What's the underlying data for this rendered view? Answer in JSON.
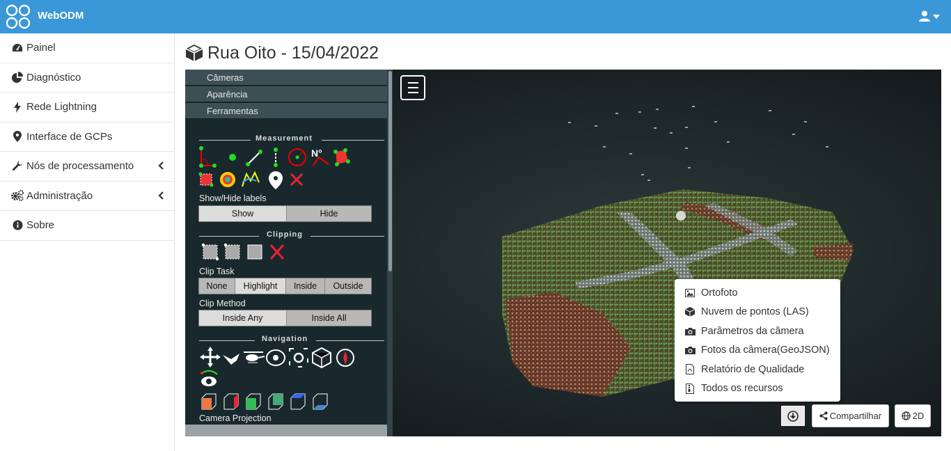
{
  "app": {
    "brand": "WebODM"
  },
  "sidebar": {
    "items": [
      {
        "label": "Painel",
        "icon": "dashboard-icon"
      },
      {
        "label": "Diagnóstico",
        "icon": "pie-chart-icon"
      },
      {
        "label": "Rede Lightning",
        "icon": "bolt-icon"
      },
      {
        "label": "Interface de GCPs",
        "icon": "map-marker-icon"
      },
      {
        "label": "Nós de processamento",
        "icon": "wrench-icon"
      },
      {
        "label": "Administração",
        "icon": "cogs-icon"
      },
      {
        "label": "Sobre",
        "icon": "info-circle-icon"
      }
    ]
  },
  "page": {
    "title": "Rua Oito - 15/04/2022"
  },
  "panel": {
    "accordion": [
      "Câmeras",
      "Aparência",
      "Ferramentas"
    ],
    "measurement_title": "Measurement",
    "labels_title": "Show/Hide labels",
    "labels_options": [
      "Show",
      "Hide"
    ],
    "clipping_title": "Clipping",
    "clip_task_title": "Clip Task",
    "clip_task_options": [
      "None",
      "Highlight",
      "Inside",
      "Outside"
    ],
    "clip_method_title": "Clip Method",
    "clip_method_options": [
      "Inside Any",
      "Inside All"
    ],
    "navigation_title": "Navigation",
    "camera_projection_title": "Camera Projection"
  },
  "downloads": {
    "items": [
      {
        "label": "Ortofoto",
        "icon": "image-icon"
      },
      {
        "label": "Nuvem de pontos (LAS)",
        "icon": "cube-icon"
      },
      {
        "label": "Parâmetros da câmera",
        "icon": "camera-icon"
      },
      {
        "label": "Fotos da câmera(GeoJSON)",
        "icon": "camera-icon"
      },
      {
        "label": "Relatório de Qualidade",
        "icon": "file-pdf-icon"
      },
      {
        "label": "Todos os recursos",
        "icon": "file-archive-icon"
      }
    ]
  },
  "buttons": {
    "share": "Compartilhar",
    "view2d": "2D"
  },
  "colors": {
    "topbar": "#3a97d8",
    "panel_bg": "#19282c",
    "viewer_bg": "#1d2227"
  }
}
